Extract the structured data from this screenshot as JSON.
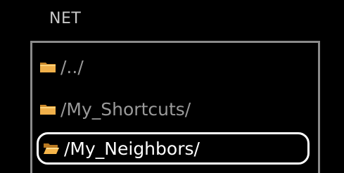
{
  "header": {
    "title": "NET"
  },
  "list": {
    "items": [
      {
        "label": "/../",
        "icon": "folder-closed-icon",
        "selected": false
      },
      {
        "label": "/My_Shortcuts/",
        "icon": "folder-closed-icon",
        "selected": false
      },
      {
        "label": "/My_Neighbors/",
        "icon": "folder-open-icon",
        "selected": true
      }
    ]
  },
  "colors": {
    "background": "#000000",
    "text_normal": "#9a9a9a",
    "text_selected": "#ffffff",
    "folder": "#e8a63a"
  }
}
